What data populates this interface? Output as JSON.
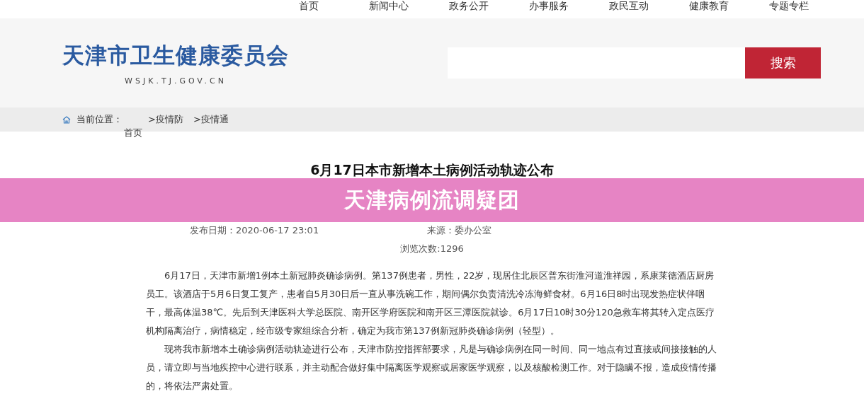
{
  "nav": [
    {
      "label": "首页"
    },
    {
      "label": "新闻中心"
    },
    {
      "label": "政务公开"
    },
    {
      "label": "办事服务"
    },
    {
      "label": "政民互动"
    },
    {
      "label": "健康教育"
    },
    {
      "label": "专题专栏"
    }
  ],
  "logo": {
    "title": "天津市卫生健康委员会",
    "domain": "WSJK.TJ.GOV.CN"
  },
  "search": {
    "button": "搜索"
  },
  "breadcrumb": {
    "label": "当前位置：",
    "items": [
      "首页",
      ">疫情防",
      ">疫情通"
    ]
  },
  "article": {
    "title": "6月17日本市新增本土病例活动轨迹公布",
    "date": "发布日期：2020-06-17 23:01",
    "source": "来源：委办公室",
    "views": "浏览次数:1296",
    "paragraphs": [
      "6月17日，天津市新增1例本土新冠肺炎确诊病例。第137例患者，男性，22岁，现居住北辰区普东街淮河道淮祥园，系康莱德酒店厨房员工。该酒店于5月6日复工复产，患者自5月30日后一直从事洗碗工作，期间偶尔负责清洗冷冻海鲜食材。6月16日8时出现发热症状伴咽干，最高体温38℃。先后到天津医科大学总医院、南开区学府医院和南开区三潭医院就诊。6月17日10时30分120急救车将其转入定点医疗机构隔离治疗，病情稳定，经市级专家组综合分析，确定为我市第137例新冠肺炎确诊病例（轻型）。",
      "现将我市新增本土确诊病例活动轨迹进行公布，天津市防控指挥部要求，凡是与确诊病例在同一时间、同一地点有过直接或间接接触的人员，请立即与当地疾控中心进行联系，并主动配合做好集中隔离医学观察或居家医学观察，以及核酸检测工作。对于隐瞒不报，造成疫情传播的，将依法严肃处置。"
    ]
  },
  "banner": {
    "text": "天津病例流调疑团"
  }
}
